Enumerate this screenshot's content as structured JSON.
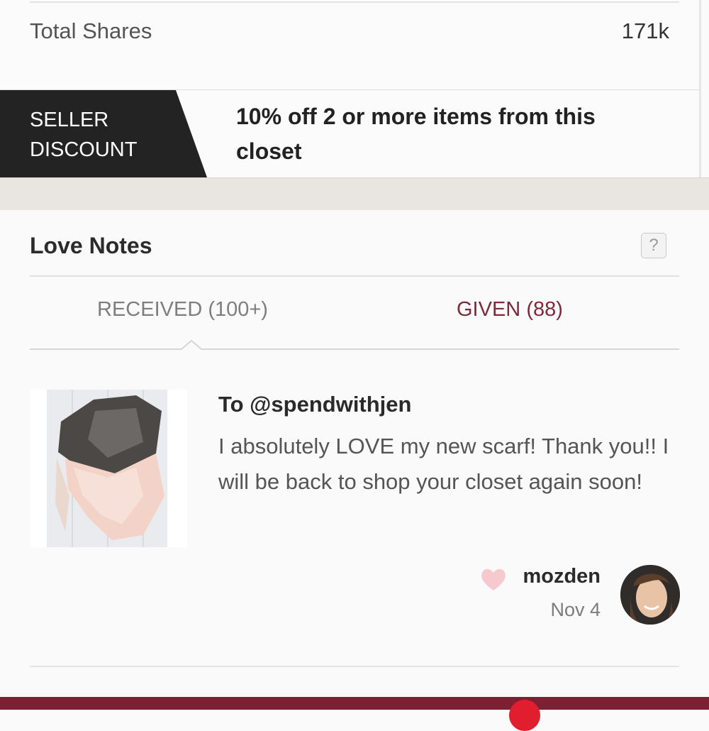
{
  "stats": {
    "total_shares_label": "Total Shares",
    "total_shares_value": "171k"
  },
  "seller_discount": {
    "badge_line1": "SELLER",
    "badge_line2": "DISCOUNT",
    "text": "10% off 2 or more items from this closet"
  },
  "love_notes": {
    "title": "Love Notes",
    "help_icon": "?",
    "tabs": [
      {
        "label": "RECEIVED",
        "count": "(100+)",
        "active": true
      },
      {
        "label": "GIVEN",
        "count": "(88)",
        "active": false
      }
    ],
    "note": {
      "to": "To @spendwithjen",
      "message": "I absolutely LOVE my new scarf! Thank you!! I will be back to shop your closet again soon!",
      "author": "mozden",
      "date": "Nov 4",
      "thumbnail_icon": "scarf-photo",
      "like_icon": "heart-icon"
    }
  },
  "colors": {
    "badge_bg": "#232323",
    "given_tab": "#7d2a3c",
    "bottom_bar": "#7b2133",
    "heart": "#f6c9cf"
  }
}
